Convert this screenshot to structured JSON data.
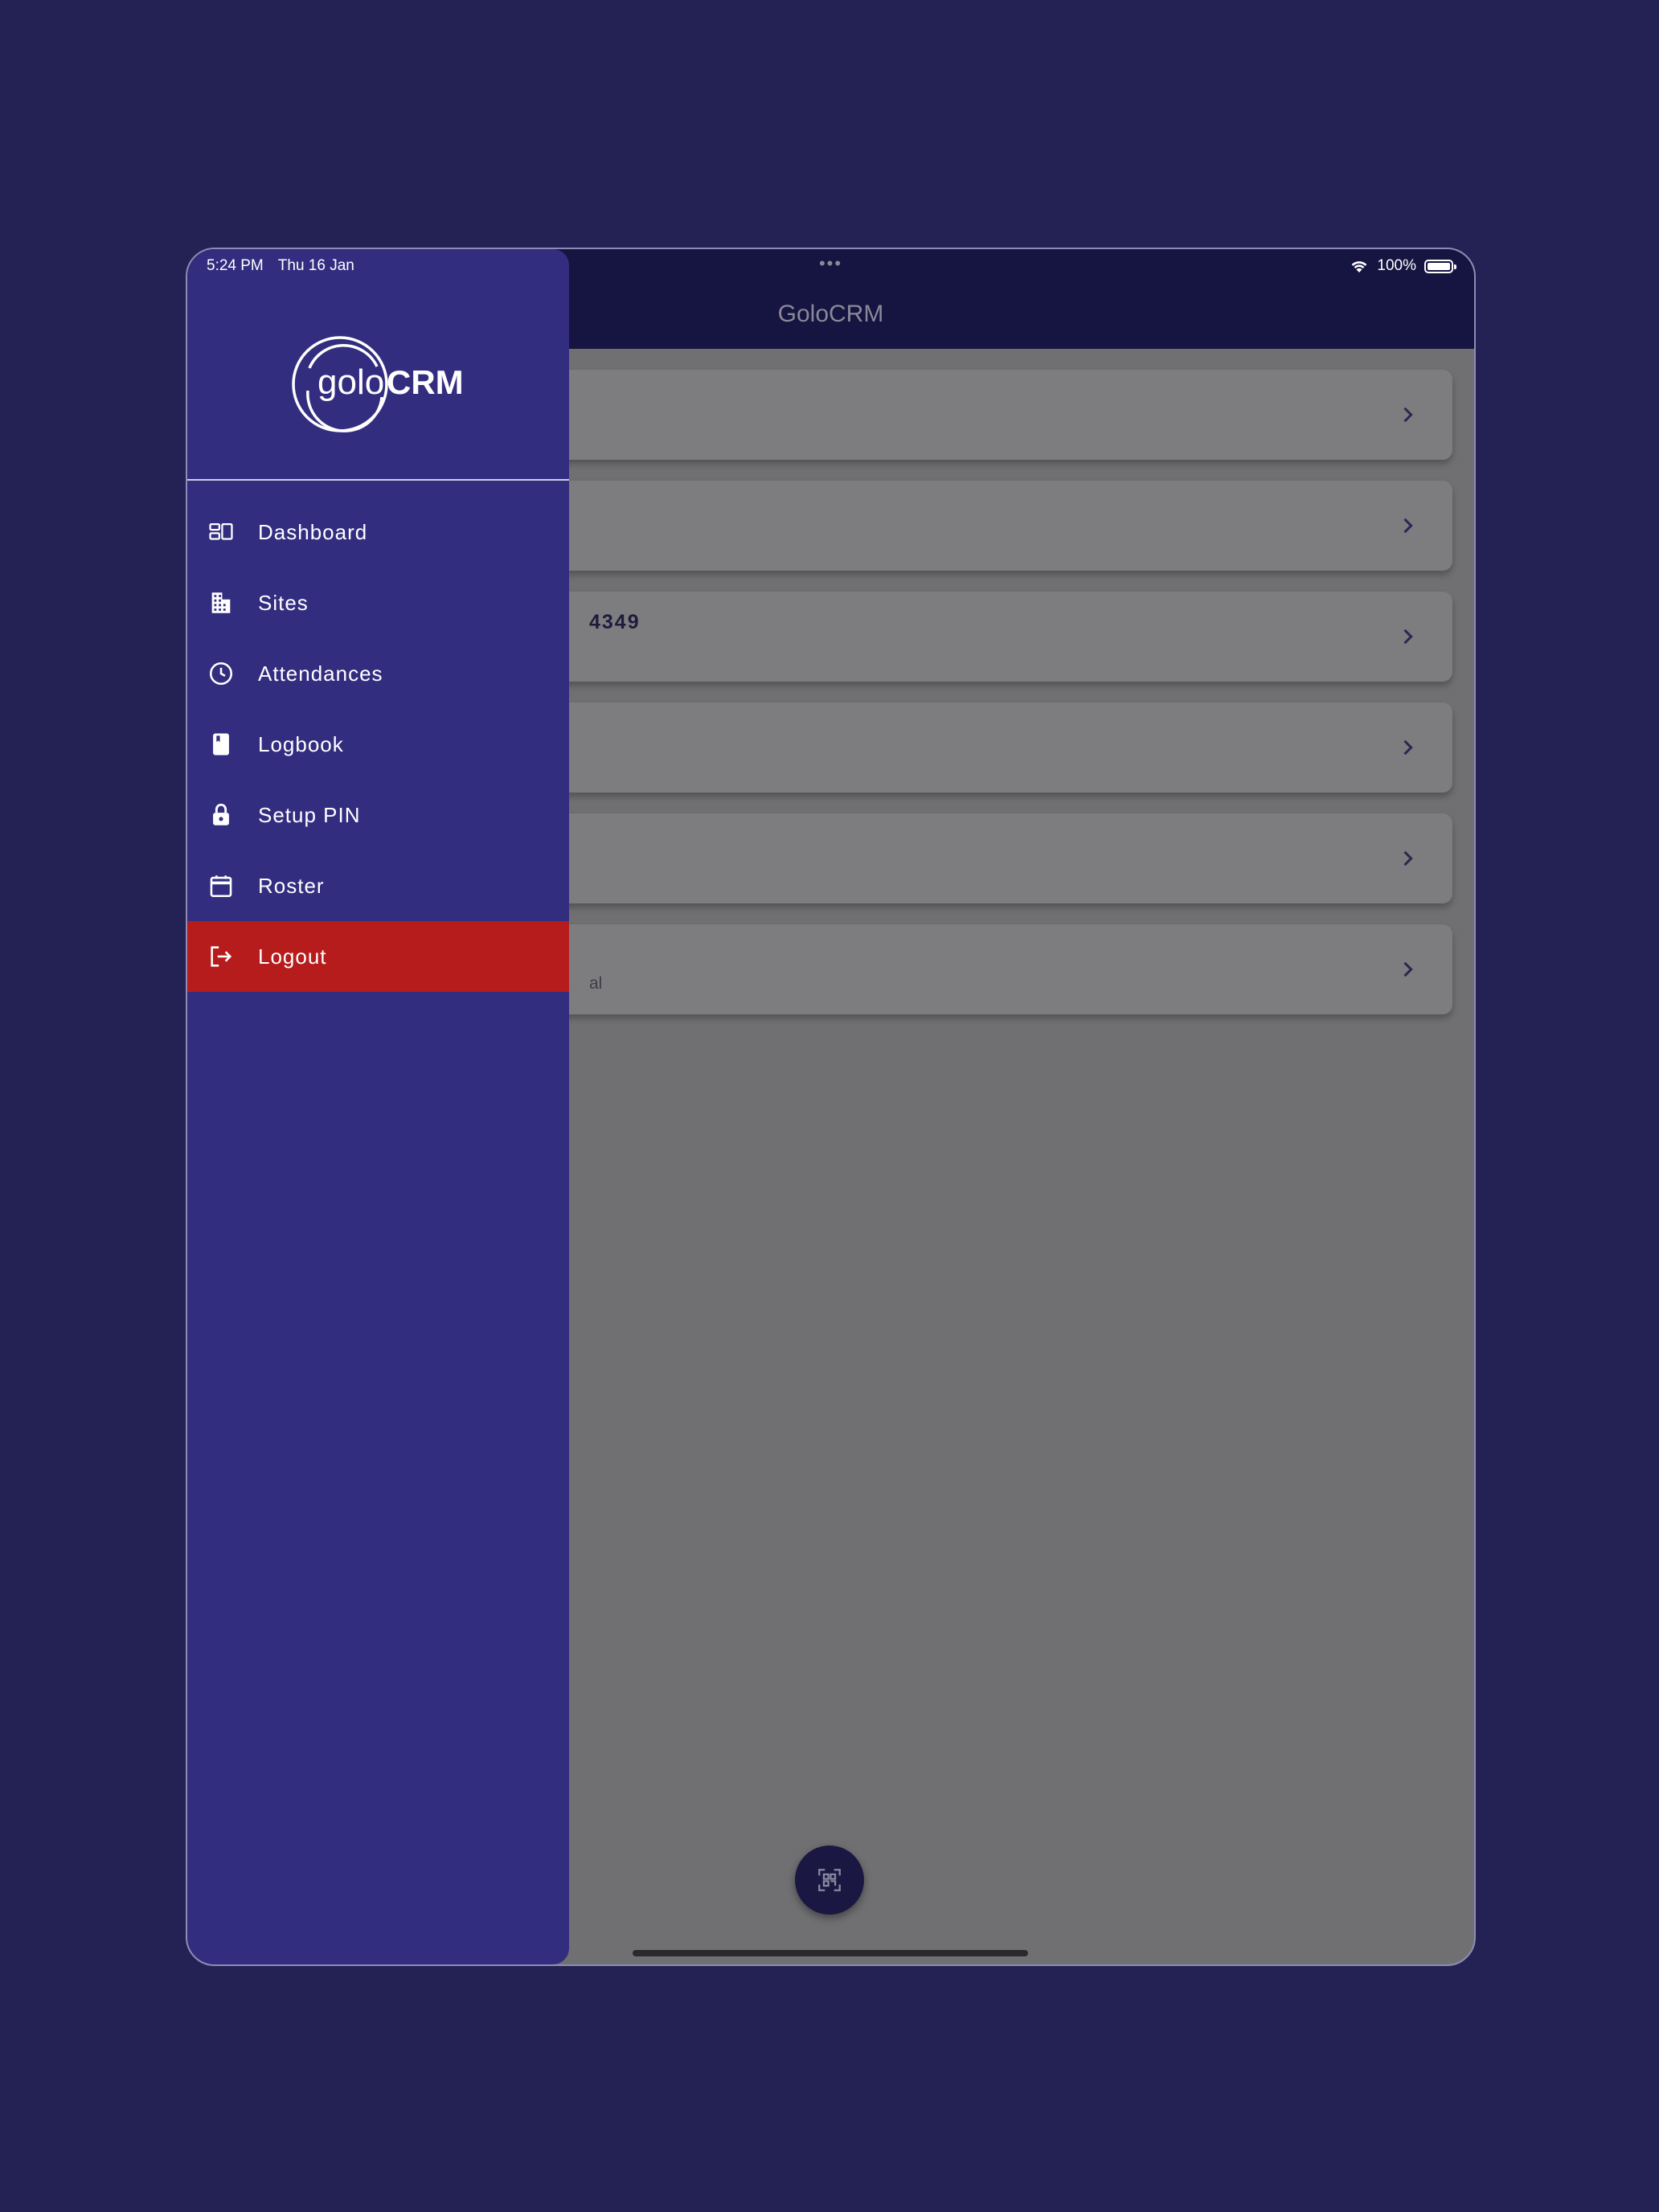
{
  "status_bar": {
    "time": "5:24 PM",
    "date": "Thu 16 Jan",
    "dots": "•••",
    "battery_percent": "100%",
    "wifi_icon": "wifi-icon",
    "battery_icon": "battery-full-icon"
  },
  "app_bar": {
    "title": "GoloCRM"
  },
  "logo": {
    "text_light": "golo",
    "text_bold": "CRM"
  },
  "drawer": {
    "items": [
      {
        "label": "Dashboard",
        "icon": "dashboard-icon"
      },
      {
        "label": "Sites",
        "icon": "building-icon"
      },
      {
        "label": "Attendances",
        "icon": "clock-icon"
      },
      {
        "label": "Logbook",
        "icon": "book-icon"
      },
      {
        "label": "Setup PIN",
        "icon": "lock-icon"
      },
      {
        "label": "Roster",
        "icon": "calendar-icon"
      },
      {
        "label": "Logout",
        "icon": "logout-icon",
        "active": true
      }
    ]
  },
  "list": {
    "cards": [
      {
        "title": "",
        "subtitle": ""
      },
      {
        "title": "",
        "subtitle": ""
      },
      {
        "title": "4349",
        "subtitle": ""
      },
      {
        "title": "",
        "subtitle": ""
      },
      {
        "title": "",
        "subtitle": ""
      },
      {
        "title": "",
        "subtitle": "al"
      }
    ]
  },
  "fab": {
    "icon": "qr-scan-icon"
  },
  "colors": {
    "background": "#242154",
    "drawer": "#332d80",
    "app_bar": "#161440",
    "logout_active": "#b71c1c",
    "scrim_content": "#707072"
  }
}
